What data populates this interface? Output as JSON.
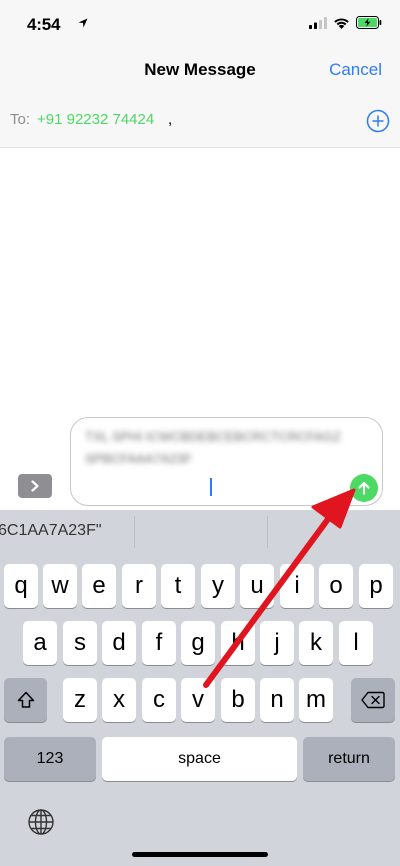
{
  "status_bar": {
    "time": "4:54",
    "location_icon": "location-arrow-icon",
    "signal_icon": "cellular-signal-icon",
    "wifi_icon": "wifi-icon",
    "battery_icon": "battery-charging-icon"
  },
  "nav": {
    "title": "New Message",
    "cancel": "Cancel"
  },
  "to": {
    "label": "To:",
    "recipient": "+91 92232 74424",
    "separator": ",",
    "add_icon": "add-contact-plus-icon"
  },
  "composer": {
    "message_text": "TXL SPHI ICWCBDEBCEBCRCTCRCFAGZ SPBCFAAA7A23F",
    "apps_icon": "chevron-right-icon",
    "send_icon": "send-arrow-up-icon"
  },
  "keyboard": {
    "suggestions": [
      "6C1AA7A23F\"",
      "",
      ""
    ],
    "row1": [
      "q",
      "w",
      "e",
      "r",
      "t",
      "y",
      "u",
      "i",
      "o",
      "p"
    ],
    "row2": [
      "a",
      "s",
      "d",
      "f",
      "g",
      "h",
      "j",
      "k",
      "l"
    ],
    "row3": [
      "z",
      "x",
      "c",
      "v",
      "b",
      "n",
      "m"
    ],
    "shift_icon": "shift-arrow-icon",
    "delete_icon": "backspace-icon",
    "numbers_label": "123",
    "space_label": "space",
    "return_label": "return",
    "globe_icon": "globe-icon"
  },
  "colors": {
    "accent": "#2f7bf5",
    "imessage_green": "#4cd964",
    "annotation_red": "#e0151f"
  }
}
